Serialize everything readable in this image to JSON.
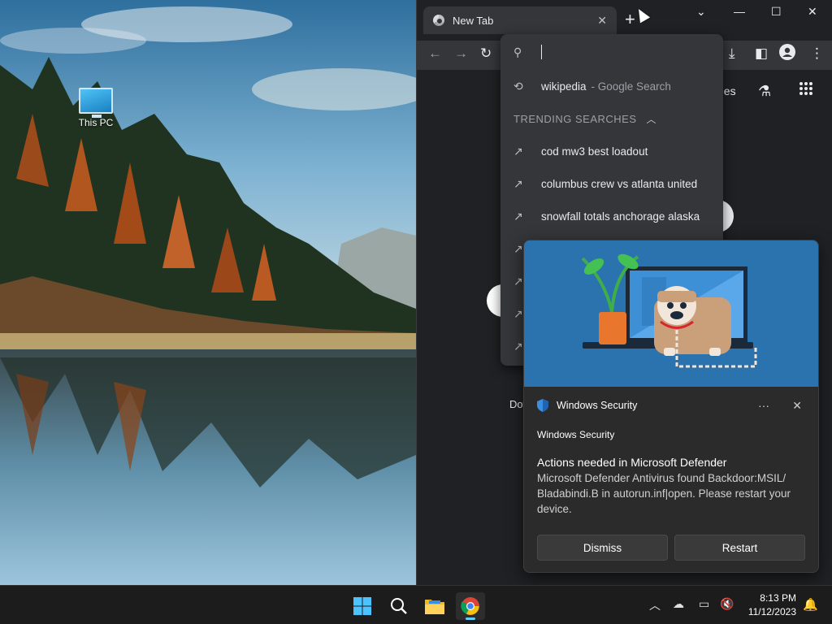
{
  "desktop": {
    "icons": [
      {
        "label": "This PC",
        "icon": "monitor-icon"
      }
    ]
  },
  "chrome": {
    "tab_title": "New Tab",
    "tab_close": "✕",
    "new_tab_symbol": "+",
    "page_partial_text": "ges",
    "page_partial_text_2": "Dov"
  },
  "omnibox": {
    "history_item": {
      "query": "wikipedia",
      "suffix": "- Google Search"
    },
    "trending_heading": "TRENDING SEARCHES",
    "trending": [
      "cod mw3 best loadout",
      "columbus crew vs atlanta united",
      "snowfall totals anchorage alaska"
    ]
  },
  "toast": {
    "header_title": "Windows Security",
    "app_name": "Windows Security",
    "title": "Actions needed in Microsoft Defender",
    "body": "Microsoft Defender Antivirus found Backdoor:MSIL/ Bladabindi.B in autorun.inf|open. Please restart your device.",
    "dismiss_label": "Dismiss",
    "restart_label": "Restart",
    "more_symbol": "···",
    "close_symbol": "✕"
  },
  "taskbar": {
    "time": "8:13 PM",
    "date": "11/12/2023"
  },
  "colors": {
    "chrome_bg": "#202124",
    "toolbar_bg": "#35363a",
    "toast_art_bg": "#2a73ae",
    "taskbar_bg": "#1c1c1c",
    "accent": "#60cdff"
  }
}
